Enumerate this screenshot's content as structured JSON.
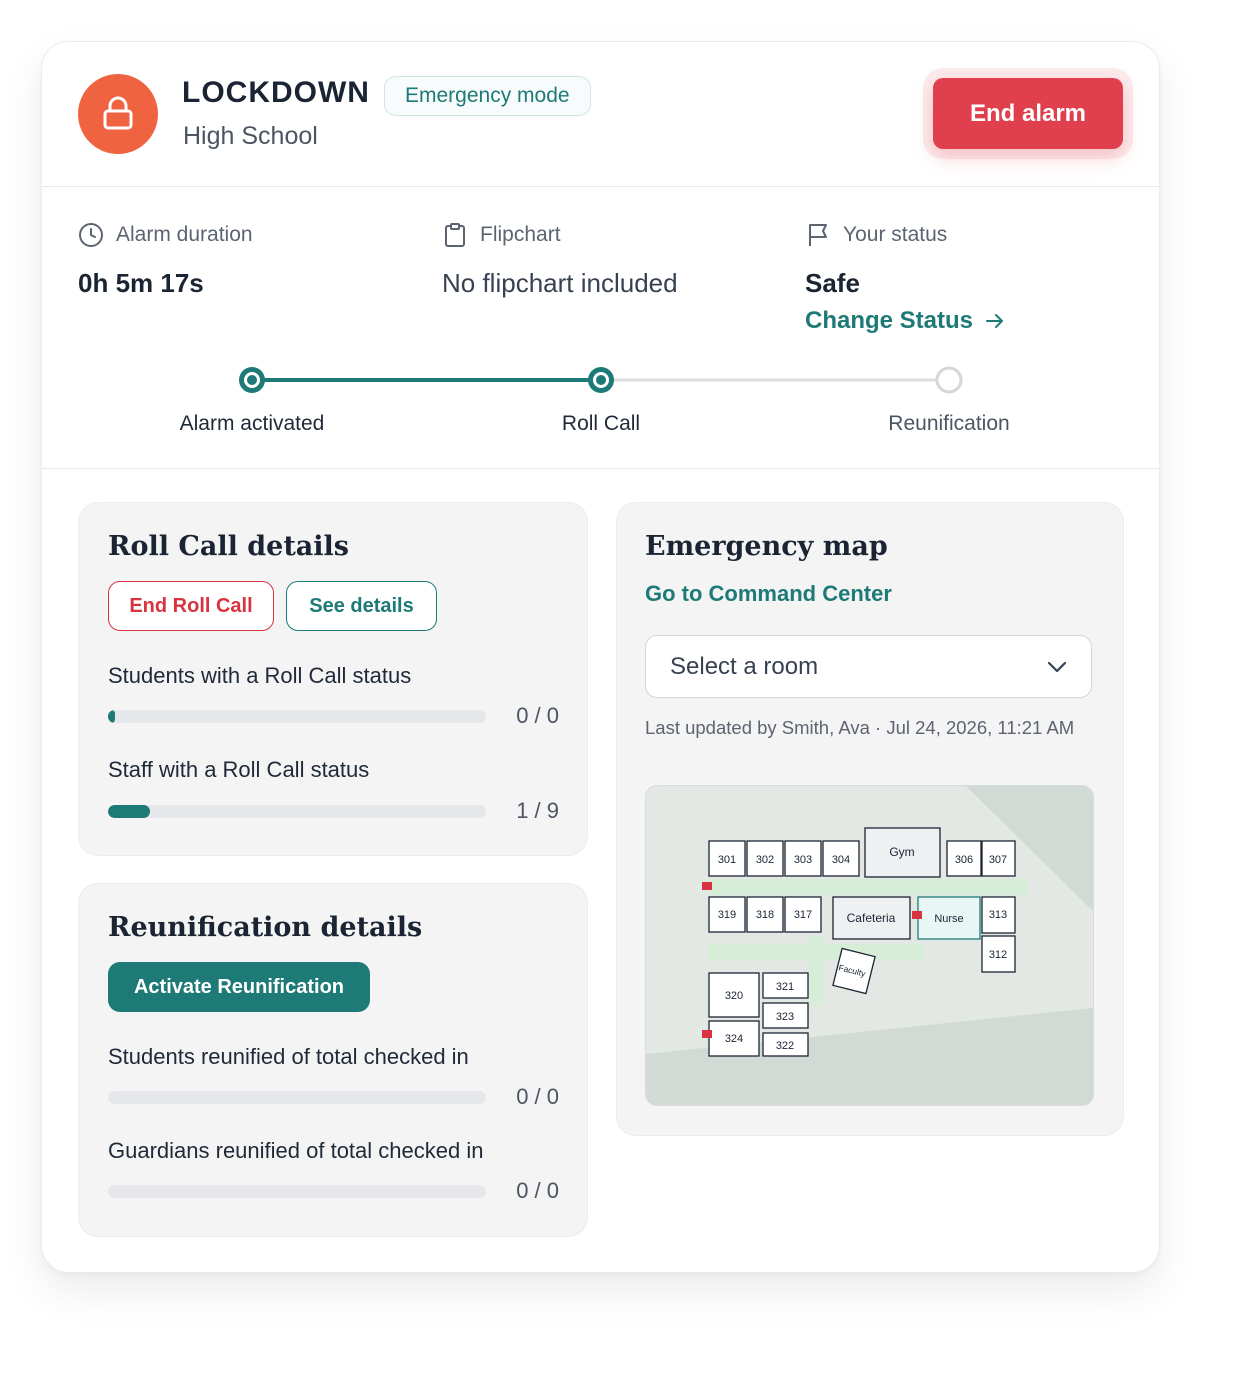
{
  "header": {
    "title": "LOCKDOWN",
    "subtitle": "High School",
    "mode_badge": "Emergency mode",
    "end_alarm_label": "End alarm",
    "icon": "lock-icon"
  },
  "info": {
    "duration_label": "Alarm duration",
    "duration_value": "0h 5m 17s",
    "flipchart_label": "Flipchart",
    "flipchart_value": "No flipchart included",
    "status_label": "Your status",
    "status_value": "Safe",
    "change_status_label": "Change Status"
  },
  "stepper": {
    "steps": [
      {
        "label": "Alarm activated",
        "state": "complete"
      },
      {
        "label": "Roll Call",
        "state": "current"
      },
      {
        "label": "Reunification",
        "state": "pending"
      }
    ]
  },
  "roll_call": {
    "title": "Roll Call details",
    "end_button": "End Roll Call",
    "details_button": "See details",
    "metrics": [
      {
        "label": "Students with a Roll Call status",
        "count": "0 / 0",
        "progress": 0
      },
      {
        "label": "Staff with a Roll Call status",
        "count": "1 / 9",
        "progress": 0.111
      }
    ]
  },
  "reunification": {
    "title": "Reunification details",
    "activate_button": "Activate Reunification",
    "metrics": [
      {
        "label": "Students reunified of total checked in",
        "count": "0 / 0",
        "progress": 0
      },
      {
        "label": "Guardians reunified of total checked in",
        "count": "0 / 0",
        "progress": 0
      }
    ]
  },
  "map": {
    "title": "Emergency map",
    "command_center_link": "Go to Command Center",
    "select_placeholder": "Select a room",
    "last_updated": "Last updated by Smith, Ava · Jul 24, 2026, 11:21 AM",
    "rooms": {
      "r301": "301",
      "r302": "302",
      "r303": "303",
      "r304": "304",
      "gym": "Gym",
      "r306": "306",
      "r307": "307",
      "r319": "319",
      "r318": "318",
      "r317": "317",
      "cafeteria": "Cafeteria",
      "nurse": "Nurse",
      "r313": "313",
      "r312": "312",
      "faculty": "Faculty",
      "r320": "320",
      "r321": "321",
      "r323": "323",
      "r324": "324",
      "r322": "322"
    }
  },
  "colors": {
    "accent": "#1e7a76",
    "alarm": "#e0404e",
    "lock_circle": "#ef6340"
  }
}
